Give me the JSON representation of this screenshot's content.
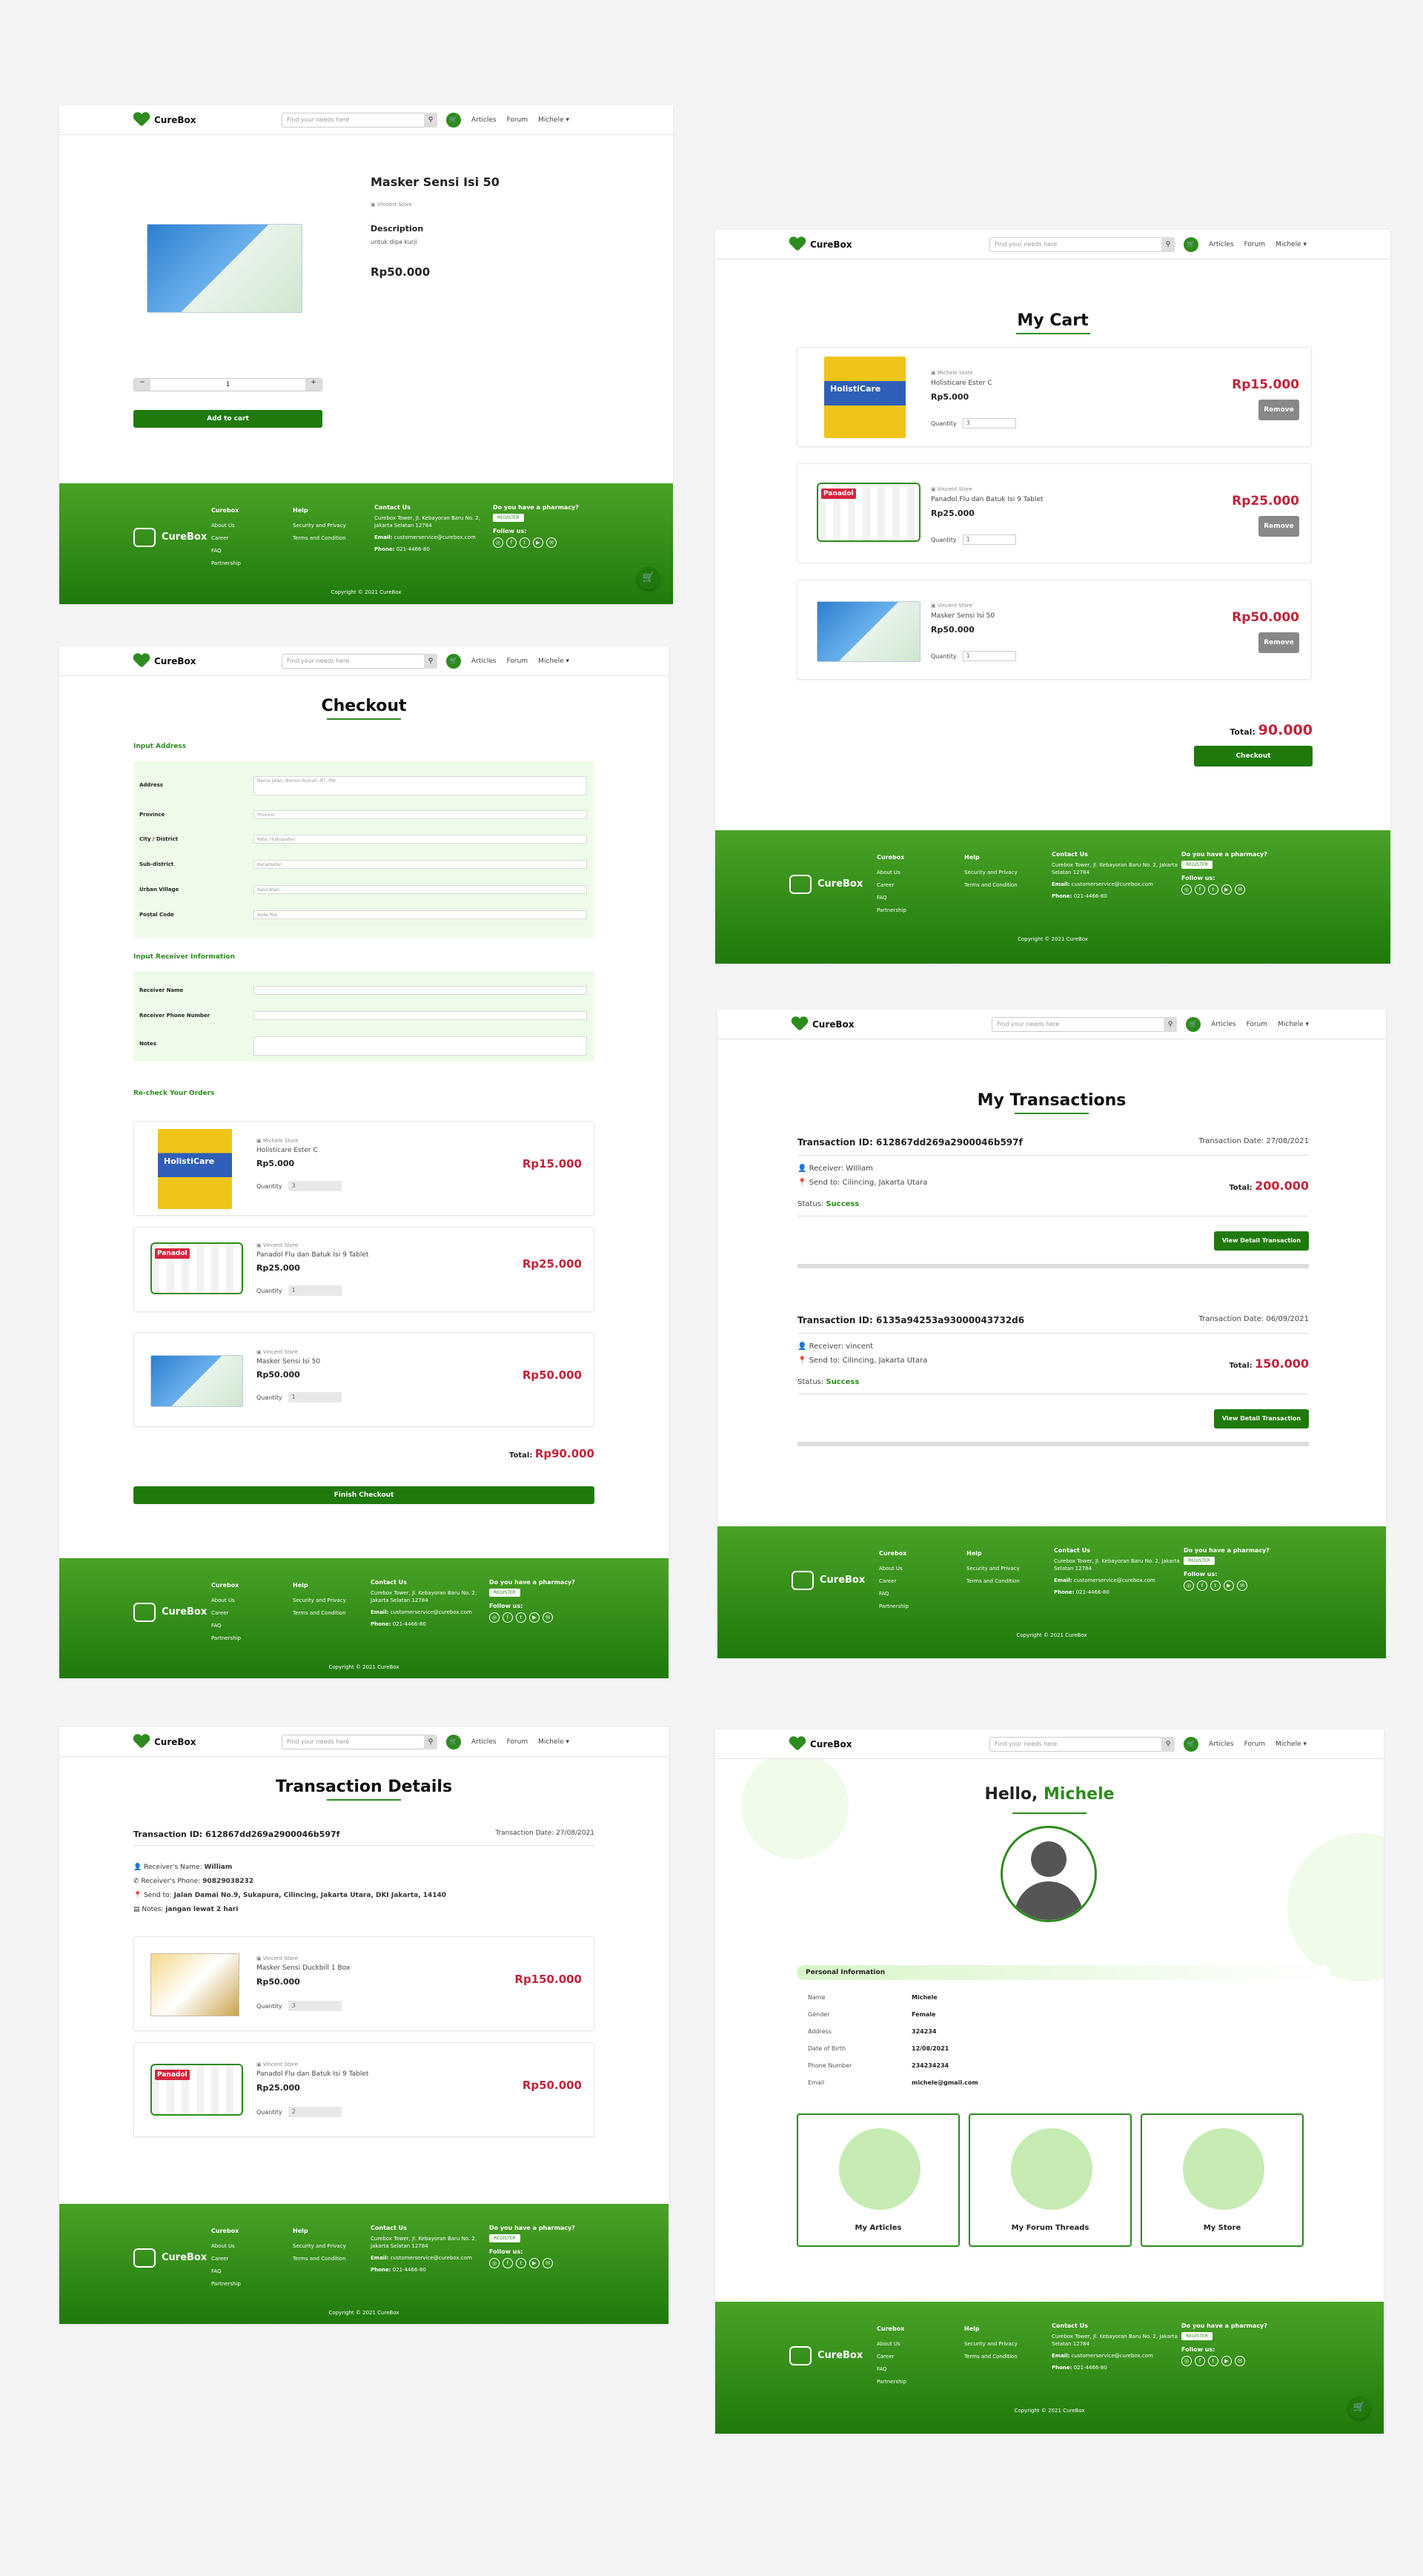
{
  "nav": {
    "brand": "CureBox",
    "search_placeholder": "Find your needs here",
    "articles": "Articles",
    "forum": "Forum",
    "user": "Michele ▾"
  },
  "footer": {
    "brand": "CureBox",
    "col1": {
      "title": "Curebox",
      "items": [
        "About Us",
        "Career",
        "FAQ",
        "Partnership"
      ]
    },
    "col2": {
      "title": "Help",
      "items": [
        "Security and Privacy",
        "Terms and Condition"
      ]
    },
    "contact": {
      "title": "Contact Us",
      "address": "Curebox Tower, Jl. Kebayoran Baru No. 2, Jakarta Selatan 12784",
      "email_label": "Email:",
      "email": "customerservice@curebox.com",
      "phone_label": "Phone:",
      "phone": "021-4466-80"
    },
    "pharmacy": {
      "title": "Do you have a pharmacy?",
      "register": "REGISTER",
      "follow": "Follow us:"
    },
    "copyright": "Copyright © 2021 CureBox"
  },
  "product": {
    "name": "Masker Sensi Isi 50",
    "store": "Vincent Store",
    "desc_title": "Description",
    "desc": "untuk dipa kurji",
    "price": "Rp50.000",
    "qty": "1",
    "minus": "−",
    "plus": "+",
    "add_to_cart": "Add to cart"
  },
  "cart": {
    "title": "My Cart",
    "items": [
      {
        "store": "Michele Store",
        "name": "Holisticare Ester C",
        "price": "Rp5.000",
        "qty_label": "Quantity",
        "qty": "3",
        "total": "Rp15.000",
        "remove": "Remove"
      },
      {
        "store": "Vincent Store",
        "name": "Panadol Flu dan Batuk Isi 9 Tablet",
        "price": "Rp25.000",
        "qty_label": "Quantity",
        "qty": "1",
        "total": "Rp25.000",
        "remove": "Remove"
      },
      {
        "store": "Vincent Store",
        "name": "Masker Sensi Isi 50",
        "price": "Rp50.000",
        "qty_label": "Quantity",
        "qty": "1",
        "total": "Rp50.000",
        "remove": "Remove"
      }
    ],
    "total_label": "Total:",
    "total": "90.000",
    "checkout": "Checkout"
  },
  "checkout": {
    "title": "Checkout",
    "addr_section": "Input Address",
    "fields": [
      {
        "label": "Address",
        "placeholder": "Nama Jalan, Nomor Rumah, RT, RW"
      },
      {
        "label": "Province",
        "placeholder": "Provinsi"
      },
      {
        "label": "City / District",
        "placeholder": "Kota / Kabupaten"
      },
      {
        "label": "Sub-district",
        "placeholder": "Kecamatan"
      },
      {
        "label": "Urban Village",
        "placeholder": "Kelurahan"
      },
      {
        "label": "Postal Code",
        "placeholder": "Kode Pos"
      }
    ],
    "recv_section": "Input Receiver Information",
    "recv_fields": [
      "Receiver Name",
      "Receiver Phone Number",
      "Notes"
    ],
    "orders_section": "Re-check Your Orders",
    "items": [
      {
        "store": "Michele Store",
        "name": "Holisticare Ester C",
        "price": "Rp5.000",
        "qty_label": "Quantity",
        "qty": "3",
        "total": "Rp15.000"
      },
      {
        "store": "Vincent Store",
        "name": "Panadol Flu dan Batuk Isi 9 Tablet",
        "price": "Rp25.000",
        "qty_label": "Quantity",
        "qty": "1",
        "total": "Rp25.000"
      },
      {
        "store": "Vincent Store",
        "name": "Masker Sensi Isi 50",
        "price": "Rp50.000",
        "qty_label": "Quantity",
        "qty": "1",
        "total": "Rp50.000"
      }
    ],
    "total_label": "Total:",
    "total": "Rp90.000",
    "finish": "Finish Checkout"
  },
  "transactions": {
    "title": "My Transactions",
    "items": [
      {
        "id": "Transaction ID: 612867dd269a2900046b597f",
        "date": "Transaction Date: 27/08/2021",
        "receiver": "Receiver: William",
        "send": "Send to: Cilincing, Jakarta Utara",
        "status_label": "Status:",
        "status": "Success",
        "total_label": "Total:",
        "total": "200.000",
        "btn": "View Detail Transaction"
      },
      {
        "id": "Transaction ID: 6135a94253a93000043732d6",
        "date": "Transaction Date: 06/09/2021",
        "receiver": "Receiver: vincent",
        "send": "Send to: Cilincing, Jakarta Utara",
        "status_label": "Status:",
        "status": "Success",
        "total_label": "Total:",
        "total": "150.000",
        "btn": "View Detail Transaction"
      }
    ]
  },
  "details": {
    "title": "Transaction Details",
    "id": "Transaction ID: 612867dd269a2900046b597f",
    "date": "Transaction Date: 27/08/2021",
    "rows": [
      {
        "label": "Receiver's Name:",
        "value": "William"
      },
      {
        "label": "Receiver's Phone:",
        "value": "90829038232"
      },
      {
        "label": "Send to:",
        "value": "Jalan Damai No.9, Sukapura, Cilincing, Jakarta Utara, DKI Jakarta, 14140"
      },
      {
        "label": "Notes:",
        "value": "jangan lewat 2 hari"
      }
    ],
    "items": [
      {
        "store": "Vincent Store",
        "name": "Masker Sensi Duckbill 1 Box",
        "price": "Rp50.000",
        "qty_label": "Quantity",
        "qty": "3",
        "total": "Rp150.000"
      },
      {
        "store": "Vincent Store",
        "name": "Panadol Flu dan Batuk Isi 9 Tablet",
        "price": "Rp25.000",
        "qty_label": "Quantity",
        "qty": "2",
        "total": "Rp50.000"
      }
    ]
  },
  "profile": {
    "hello": "Hello,",
    "name": "Michele",
    "section": "Personal Information",
    "rows": [
      {
        "label": "Name",
        "value": "Michele"
      },
      {
        "label": "Gender",
        "value": "Female"
      },
      {
        "label": "Address",
        "value": "324234"
      },
      {
        "label": "Date of Birth",
        "value": "12/08/2021"
      },
      {
        "label": "Phone Number",
        "value": "234234234"
      },
      {
        "label": "Email",
        "value": "michele@gmail.com"
      }
    ],
    "cards": [
      "My Articles",
      "My Forum Threads",
      "My Store"
    ]
  }
}
